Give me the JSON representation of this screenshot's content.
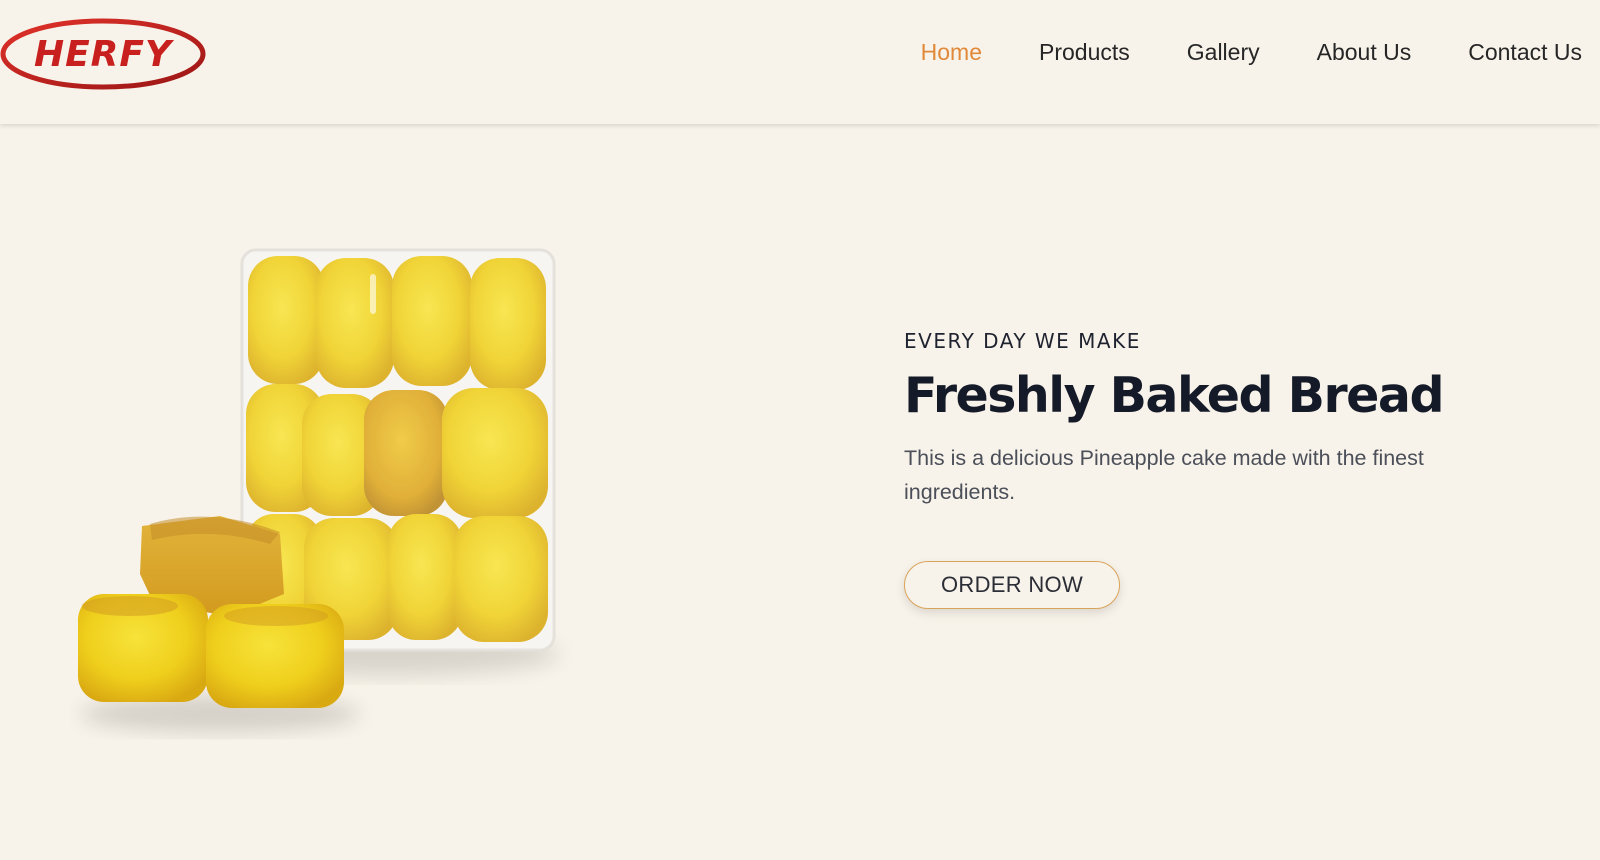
{
  "brand": {
    "logo_text": "HERFY",
    "logo_color": "#c8201e"
  },
  "nav": {
    "items": [
      {
        "label": "Home",
        "active": true
      },
      {
        "label": "Products",
        "active": false
      },
      {
        "label": "Gallery",
        "active": false
      },
      {
        "label": "About Us",
        "active": false
      },
      {
        "label": "Contact Us",
        "active": false
      }
    ],
    "active_color": "#e0893a"
  },
  "hero": {
    "eyebrow": "EVERY DAY WE MAKE",
    "title": "Freshly Baked Bread",
    "description": "This is a delicious Pineapple cake made with the finest ingredients.",
    "cta_label": "ORDER NOW",
    "cta_border_color": "#d9a45a",
    "image_subject": "pack of pineapple cakes"
  },
  "colors": {
    "background": "#f8f3ea",
    "title_text": "#141a28",
    "body_text": "#4b4f59"
  }
}
